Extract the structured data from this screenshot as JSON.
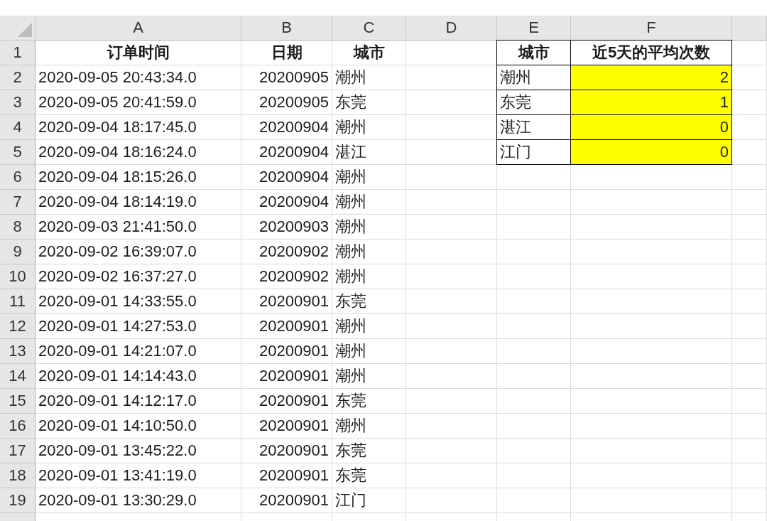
{
  "columns": [
    "A",
    "B",
    "C",
    "D",
    "E",
    "F"
  ],
  "rows": [
    {
      "number": "1",
      "kind": "header",
      "order_time": "订单时间",
      "date": "日期",
      "city": "城市",
      "summary_city": "城市",
      "summary_value": "近5天的平均次数",
      "highlighted": false
    },
    {
      "number": "2",
      "kind": "data",
      "order_time": "2020-09-05 20:43:34.0",
      "date": "20200905",
      "city": "潮州",
      "summary_city": "潮州",
      "summary_value": "2",
      "highlighted": true
    },
    {
      "number": "3",
      "kind": "data",
      "order_time": "2020-09-05 20:41:59.0",
      "date": "20200905",
      "city": "东莞",
      "summary_city": "东莞",
      "summary_value": "1",
      "highlighted": true
    },
    {
      "number": "4",
      "kind": "data",
      "order_time": "2020-09-04 18:17:45.0",
      "date": "20200904",
      "city": "潮州",
      "summary_city": "湛江",
      "summary_value": "0",
      "highlighted": true
    },
    {
      "number": "5",
      "kind": "data",
      "order_time": "2020-09-04 18:16:24.0",
      "date": "20200904",
      "city": "湛江",
      "summary_city": "江门",
      "summary_value": "0",
      "highlighted": true
    },
    {
      "number": "6",
      "kind": "data",
      "order_time": "2020-09-04 18:15:26.0",
      "date": "20200904",
      "city": "潮州"
    },
    {
      "number": "7",
      "kind": "data",
      "order_time": "2020-09-04 18:14:19.0",
      "date": "20200904",
      "city": "潮州"
    },
    {
      "number": "8",
      "kind": "data",
      "order_time": "2020-09-03 21:41:50.0",
      "date": "20200903",
      "city": "潮州"
    },
    {
      "number": "9",
      "kind": "data",
      "order_time": "2020-09-02 16:39:07.0",
      "date": "20200902",
      "city": "潮州"
    },
    {
      "number": "10",
      "kind": "data",
      "order_time": "2020-09-02 16:37:27.0",
      "date": "20200902",
      "city": "潮州"
    },
    {
      "number": "11",
      "kind": "data",
      "order_time": "2020-09-01 14:33:55.0",
      "date": "20200901",
      "city": "东莞"
    },
    {
      "number": "12",
      "kind": "data",
      "order_time": "2020-09-01 14:27:53.0",
      "date": "20200901",
      "city": "潮州"
    },
    {
      "number": "13",
      "kind": "data",
      "order_time": "2020-09-01 14:21:07.0",
      "date": "20200901",
      "city": "潮州"
    },
    {
      "number": "14",
      "kind": "data",
      "order_time": "2020-09-01 14:14:43.0",
      "date": "20200901",
      "city": "潮州"
    },
    {
      "number": "15",
      "kind": "data",
      "order_time": "2020-09-01 14:12:17.0",
      "date": "20200901",
      "city": "东莞"
    },
    {
      "number": "16",
      "kind": "data",
      "order_time": "2020-09-01 14:10:50.0",
      "date": "20200901",
      "city": "潮州"
    },
    {
      "number": "17",
      "kind": "data",
      "order_time": "2020-09-01 13:45:22.0",
      "date": "20200901",
      "city": "东莞"
    },
    {
      "number": "18",
      "kind": "data",
      "order_time": "2020-09-01 13:41:19.0",
      "date": "20200901",
      "city": "东莞"
    },
    {
      "number": "19",
      "kind": "data",
      "order_time": "2020-09-01 13:30:29.0",
      "date": "20200901",
      "city": "江门"
    }
  ]
}
